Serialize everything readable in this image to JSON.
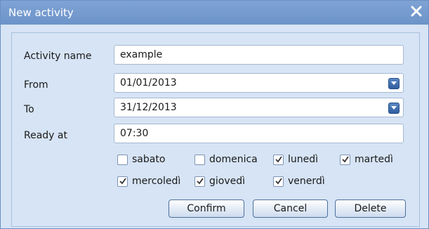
{
  "window": {
    "title": "New activity",
    "close_icon": "close-icon"
  },
  "form": {
    "activity_name": {
      "label": "Activity name",
      "value": "example"
    },
    "from": {
      "label": "From",
      "value": "01/01/2013"
    },
    "to": {
      "label": "To",
      "value": "31/12/2013"
    },
    "ready_at": {
      "label": "Ready at",
      "value": "07:30"
    }
  },
  "days": [
    {
      "label": "sabato",
      "checked": false
    },
    {
      "label": "domenica",
      "checked": false
    },
    {
      "label": "lunedì",
      "checked": true
    },
    {
      "label": "martedì",
      "checked": true
    },
    {
      "label": "mercoledì",
      "checked": true
    },
    {
      "label": "giovedì",
      "checked": true
    },
    {
      "label": "venerdì",
      "checked": true
    }
  ],
  "buttons": {
    "confirm": "Confirm",
    "cancel": "Cancel",
    "delete": "Delete"
  },
  "colors": {
    "titlebar": "#6c93c9",
    "background": "#d6e4f5",
    "accent": "#2e5d9e"
  }
}
